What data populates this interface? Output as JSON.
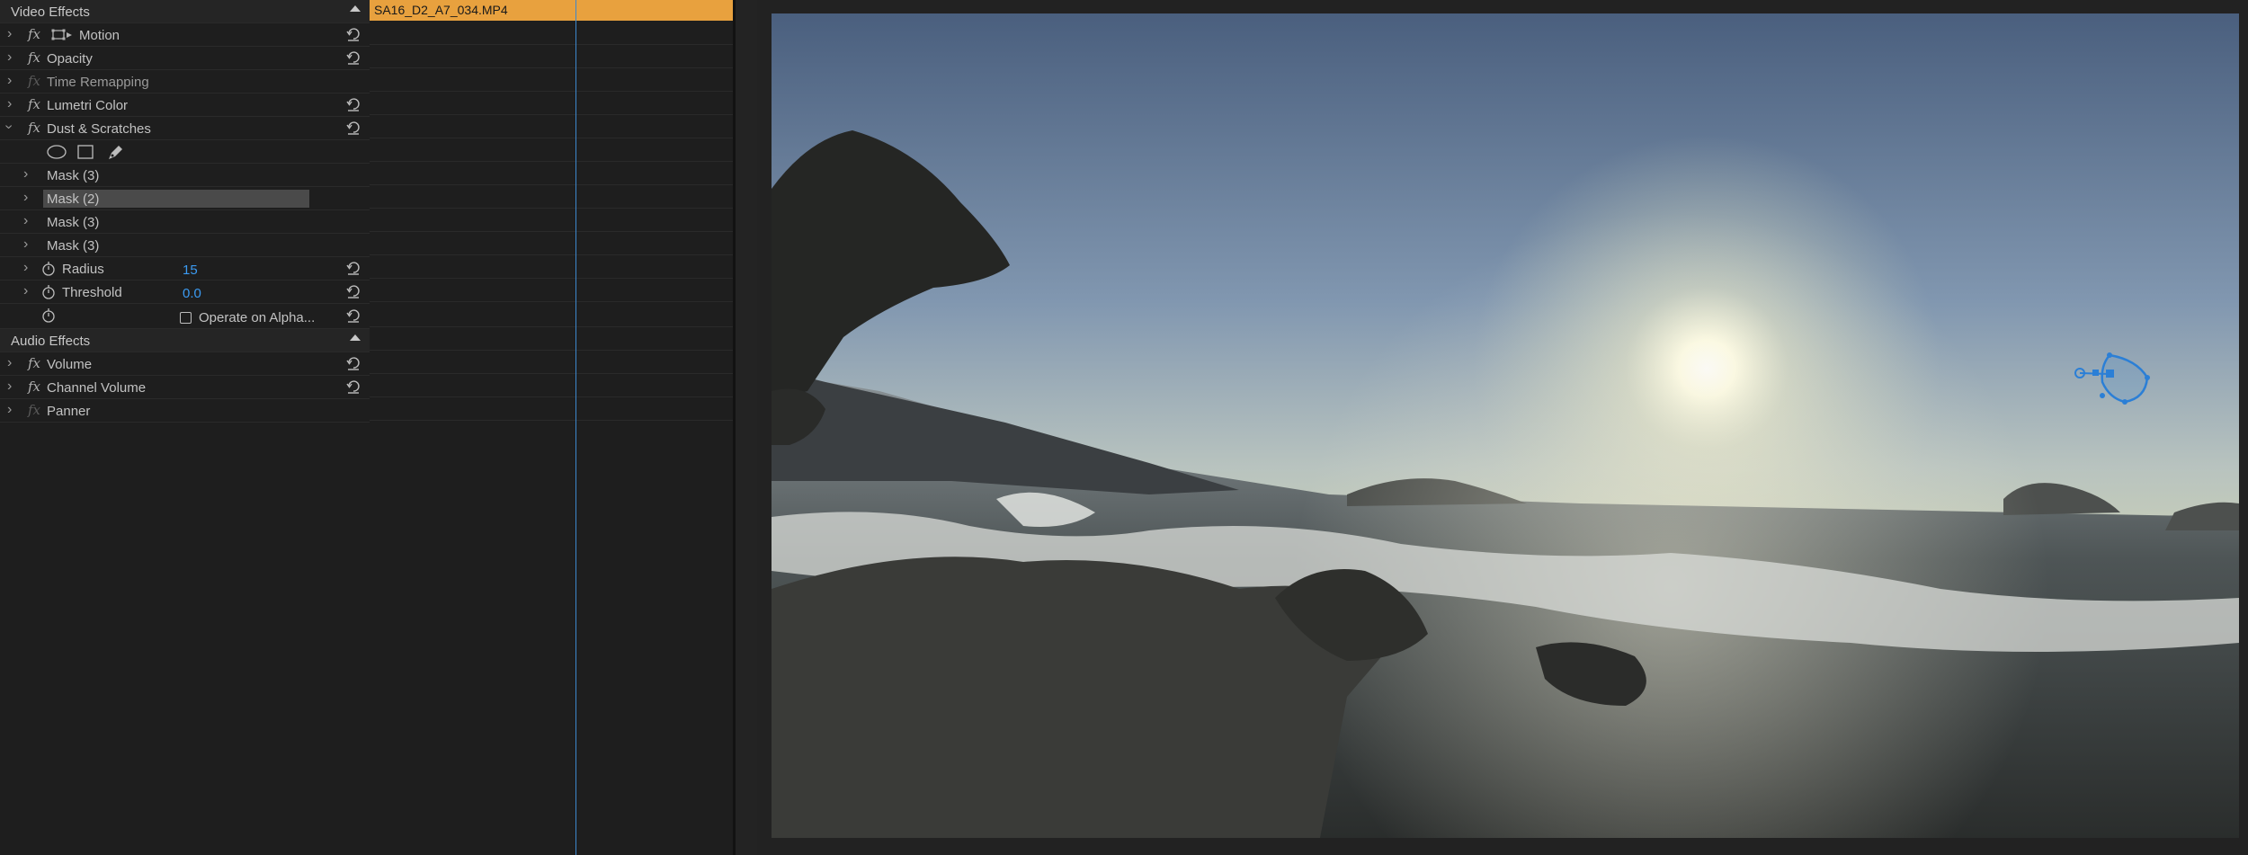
{
  "video_effects": {
    "title": "Video Effects",
    "motion": "Motion",
    "opacity": "Opacity",
    "time_remapping": "Time Remapping",
    "lumetri_color": "Lumetri Color",
    "dust_scratches": "Dust & Scratches",
    "masks": [
      "Mask (3)",
      "Mask (2)",
      "Mask (3)",
      "Mask (3)"
    ],
    "radius_label": "Radius",
    "radius_value": "15",
    "threshold_label": "Threshold",
    "threshold_value": "0.0",
    "operate_alpha_label": "Operate on Alpha..."
  },
  "audio_effects": {
    "title": "Audio Effects",
    "volume": "Volume",
    "channel_volume": "Channel Volume",
    "panner": "Panner"
  },
  "timeline": {
    "clip_name": "SA16_D2_A7_034.MP4"
  },
  "colors": {
    "clip_bar": "#e8a13e",
    "value_blue": "#3b9bf2",
    "playhead": "#3d87cc",
    "mask_path": "#2b7fd6"
  },
  "icons": [
    "fx-icon",
    "reset-icon",
    "stopwatch-icon",
    "ellipse-mask-icon",
    "rectangle-mask-icon",
    "pen-mask-icon",
    "motion-transform-icon"
  ]
}
